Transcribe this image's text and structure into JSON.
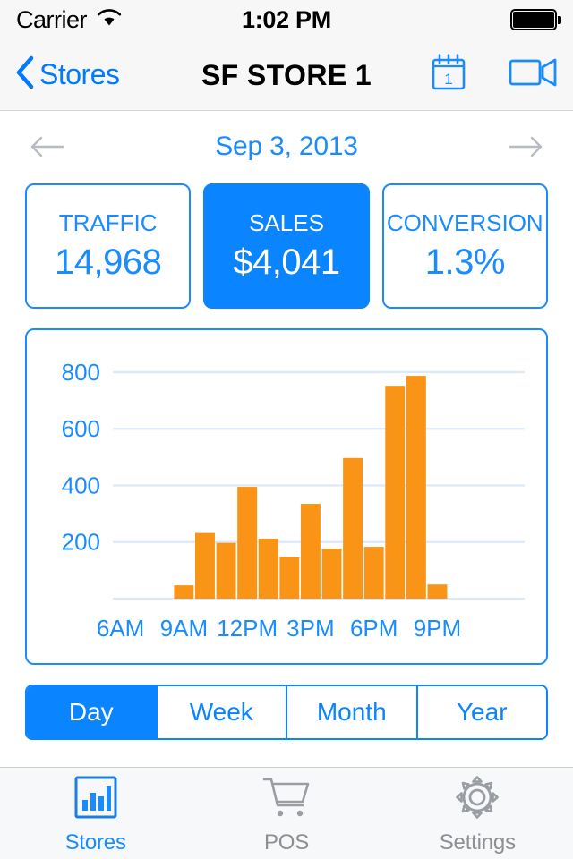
{
  "status_bar": {
    "carrier": "Carrier",
    "wifi_icon": "wifi-icon",
    "time": "1:02 PM",
    "battery_icon": "battery-full-icon"
  },
  "nav_bar": {
    "back_icon": "chevron-left-icon",
    "back_label": "Stores",
    "title": "SF STORE 1",
    "calendar_icon": "calendar-icon",
    "calendar_day": "1",
    "video_icon": "video-camera-icon"
  },
  "date_nav": {
    "prev_icon": "arrow-left-icon",
    "date": "Sep 3, 2013",
    "next_icon": "arrow-right-icon"
  },
  "kpis": [
    {
      "title": "TRAFFIC",
      "value": "14,968",
      "selected": false
    },
    {
      "title": "SALES",
      "value": "$4,041",
      "selected": true
    },
    {
      "title": "CONVERSION",
      "value": "1.3%",
      "selected": false
    }
  ],
  "period_control": {
    "options": [
      "Day",
      "Week",
      "Month",
      "Year"
    ],
    "selected": "Day"
  },
  "tab_bar": {
    "tabs": [
      {
        "label": "Stores",
        "icon": "bar-chart-icon",
        "active": true
      },
      {
        "label": "POS",
        "icon": "shopping-cart-icon",
        "active": false
      },
      {
        "label": "Settings",
        "icon": "gear-icon",
        "active": false
      }
    ]
  },
  "colors": {
    "accent_blue": "#0a84ff",
    "label_blue": "#1a8cff",
    "bar_orange": "#f99417",
    "gridline": "#dce9fb",
    "inactive_gray": "#8e8e93"
  },
  "chart_data": {
    "type": "bar",
    "title": "",
    "xlabel": "",
    "ylabel": "",
    "ylim": [
      0,
      860
    ],
    "yticks": [
      200,
      400,
      600,
      800
    ],
    "ytick_labels": [
      "200",
      "400",
      "600",
      "800"
    ],
    "xtick_labels": [
      "6AM",
      "9AM",
      "12PM",
      "3PM",
      "6PM",
      "9PM"
    ],
    "grid": true,
    "legend": "none",
    "bar_color": "#f99417",
    "categories": [
      "9AM",
      "10AM",
      "11AM",
      "12PM",
      "1PM",
      "2PM",
      "3PM",
      "4PM",
      "5PM",
      "6PM",
      "7PM",
      "8PM",
      "9PM"
    ],
    "values": [
      47,
      232,
      197,
      395,
      212,
      147,
      335,
      177,
      497,
      183,
      752,
      787,
      50
    ]
  }
}
